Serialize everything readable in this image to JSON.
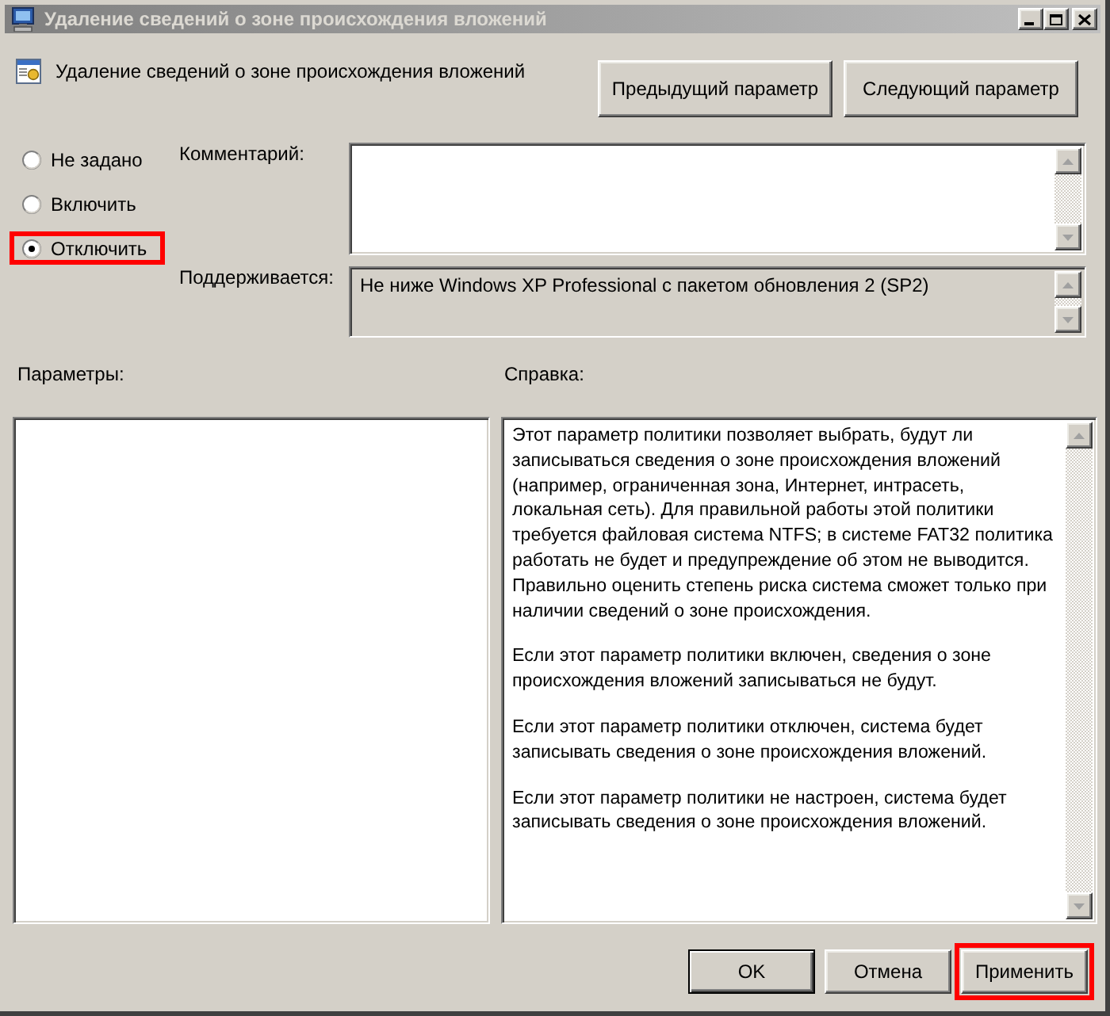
{
  "window": {
    "title": "Удаление сведений о зоне происхождения вложений"
  },
  "header": {
    "policy_name": "Удаление сведений о зоне происхождения вложений",
    "buttons": [
      {
        "label": "Предыдущий параметр"
      },
      {
        "label": "Следующий параметр"
      }
    ]
  },
  "state_options": [
    {
      "label": "Не задано",
      "selected": false,
      "highlighted": false
    },
    {
      "label": "Включить",
      "selected": false,
      "highlighted": false
    },
    {
      "label": "Отключить",
      "selected": true,
      "highlighted": true
    }
  ],
  "comment": {
    "label": "Комментарий:"
  },
  "supported": {
    "label": "Поддерживается:",
    "value": "Не ниже Windows XP Professional с пакетом обновления 2 (SP2)"
  },
  "options_pane": {
    "label": "Параметры:"
  },
  "help_pane": {
    "label": "Справка:",
    "paragraphs": [
      "Этот параметр политики позволяет выбрать, будут ли записываться сведения о зоне происхождения вложений (например, ограниченная зона, Интернет, интрасеть, локальная сеть). Для правильной работы этой политики требуется файловая система NTFS; в системе FAT32 политика работать не будет и предупреждение об этом не выводится. Правильно оценить степень риска система сможет только при наличии сведений о зоне происхождения.",
      "Если этот параметр политики включен, сведения о зоне происхождения вложений записываться не будут.",
      "Если этот параметр политики отключен, система будет записывать сведения о зоне происхождения вложений.",
      "Если этот параметр политики не настроен, система будет записывать сведения о зоне происхождения вложений."
    ]
  },
  "buttons": [
    {
      "label": "OK",
      "default": true,
      "highlighted": false
    },
    {
      "label": "Отмена",
      "default": false,
      "highlighted": false
    },
    {
      "label": "Применить",
      "default": false,
      "highlighted": true
    }
  ]
}
